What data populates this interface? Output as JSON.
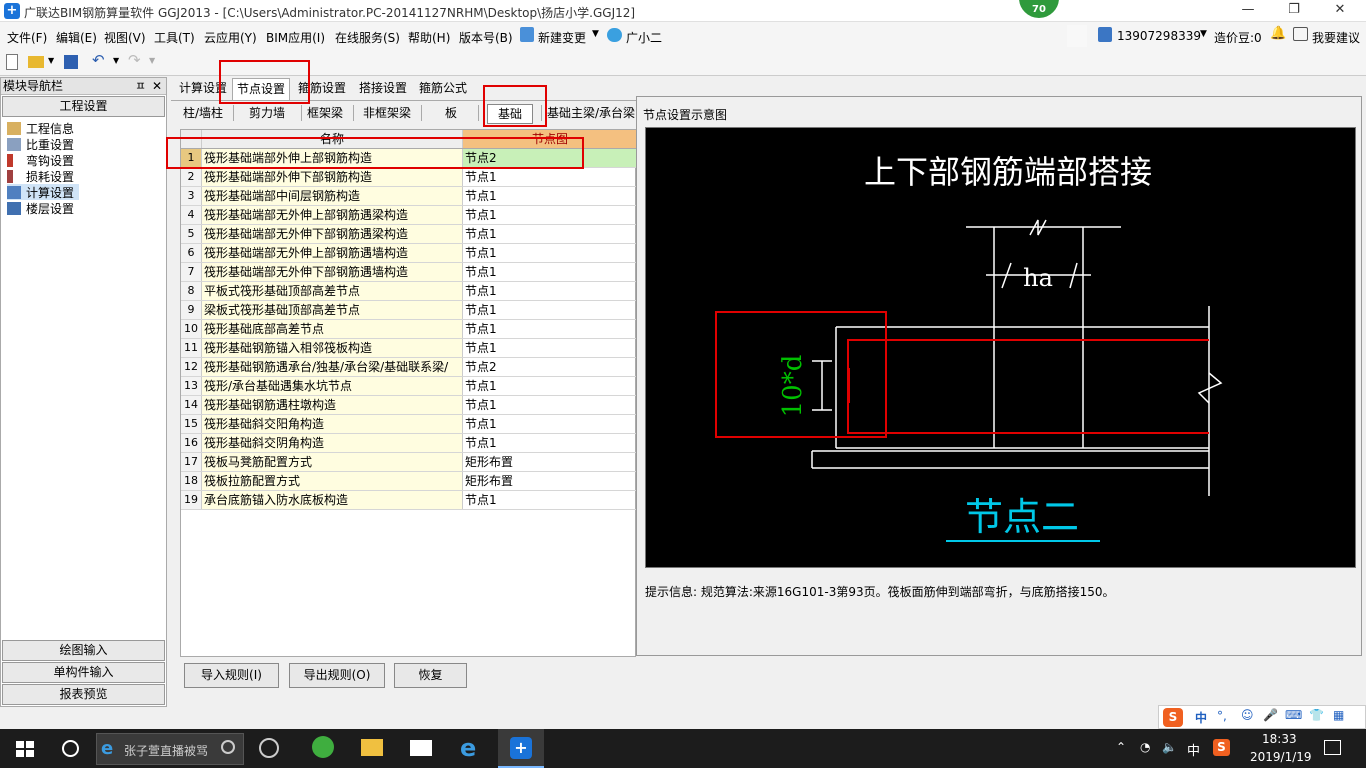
{
  "window": {
    "title": "广联达BIM钢筋算量软件 GGJ2013 - [C:\\Users\\Administrator.PC-20141127NRHM\\Desktop\\扬店小学.GGJ12]",
    "badge": "70",
    "minimize": "—",
    "maximize": "❐",
    "close": "✕"
  },
  "menu": [
    "文件(F)",
    "编辑(E)",
    "视图(V)",
    "工具(T)",
    "云应用(Y)",
    "BIM应用(I)",
    "在线服务(S)",
    "帮助(H)",
    "版本号(B)",
    "新建变更",
    "广小二"
  ],
  "menu_right": {
    "phone": "13907298339",
    "beans": "造价豆:0",
    "suggest": "我要建议"
  },
  "nav": {
    "title": "模块导航栏",
    "pin": "ㅍ",
    "close": "✕",
    "section_top": "工程设置",
    "items": [
      "工程信息",
      "比重设置",
      "弯钩设置",
      "损耗设置",
      "计算设置",
      "楼层设置"
    ],
    "sections_bottom": [
      "绘图输入",
      "单构件输入",
      "报表预览"
    ]
  },
  "tabs": [
    "计算设置",
    "节点设置",
    "箍筋设置",
    "搭接设置",
    "箍筋公式"
  ],
  "subtabs": [
    "柱/墙柱",
    "剪力墙",
    "框架梁",
    "非框架梁",
    "板",
    "基础",
    "基础主梁/承台梁"
  ],
  "grid": {
    "headers": [
      "名称",
      "节点图"
    ],
    "rows": [
      {
        "n": "1",
        "name": "筏形基础端部外伸上部钢筋构造",
        "value": "节点2"
      },
      {
        "n": "2",
        "name": "筏形基础端部外伸下部钢筋构造",
        "value": "节点1"
      },
      {
        "n": "3",
        "name": "筏形基础端部中间层钢筋构造",
        "value": "节点1"
      },
      {
        "n": "4",
        "name": "筏形基础端部无外伸上部钢筋遇梁构造",
        "value": "节点1"
      },
      {
        "n": "5",
        "name": "筏形基础端部无外伸下部钢筋遇梁构造",
        "value": "节点1"
      },
      {
        "n": "6",
        "name": "筏形基础端部无外伸上部钢筋遇墙构造",
        "value": "节点1"
      },
      {
        "n": "7",
        "name": "筏形基础端部无外伸下部钢筋遇墙构造",
        "value": "节点1"
      },
      {
        "n": "8",
        "name": "平板式筏形基础顶部高差节点",
        "value": "节点1"
      },
      {
        "n": "9",
        "name": "梁板式筏形基础顶部高差节点",
        "value": "节点1"
      },
      {
        "n": "10",
        "name": "筏形基础底部高差节点",
        "value": "节点1"
      },
      {
        "n": "11",
        "name": "筏形基础钢筋锚入相邻筏板构造",
        "value": "节点1"
      },
      {
        "n": "12",
        "name": "筏形基础钢筋遇承台/独基/承台梁/基础联系梁/",
        "value": "节点2"
      },
      {
        "n": "13",
        "name": "筏形/承台基础遇集水坑节点",
        "value": "节点1"
      },
      {
        "n": "14",
        "name": "筏形基础钢筋遇柱墩构造",
        "value": "节点1"
      },
      {
        "n": "15",
        "name": "筏形基础斜交阳角构造",
        "value": "节点1"
      },
      {
        "n": "16",
        "name": "筏形基础斜交阴角构造",
        "value": "节点1"
      },
      {
        "n": "17",
        "name": "筏板马凳筋配置方式",
        "value": "矩形布置"
      },
      {
        "n": "18",
        "name": "筏板拉筋配置方式",
        "value": "矩形布置"
      },
      {
        "n": "19",
        "name": "承台底筋锚入防水底板构造",
        "value": "节点1"
      }
    ]
  },
  "diagram": {
    "window_title": "节点设置示意图",
    "heading": "上下部钢筋端部搭接",
    "dim_ha": "ha",
    "dim_d": "10*d",
    "node_label": "节点二",
    "hint": "提示信息:  规范算法:来源16G101-3第93页。筏板面筋伸到端部弯折，与底筋搭接150。"
  },
  "buttons": [
    "导入规则(I)",
    "导出规则(O)",
    "恢复"
  ],
  "taskbar": {
    "search_placeholder": "张子萱直播被骂",
    "time": "18:33",
    "date": "2019/1/19",
    "ime": "中"
  },
  "ime_bar": [
    "中",
    "°,",
    "☺",
    "🎤",
    "⌨",
    "👕",
    "▦"
  ],
  "colors": {
    "highlight_box": "#e00000",
    "selected_value": "#c8f0b8",
    "name_cell": "#fffde0",
    "canvas_bg": "#000000",
    "dim_green": "#00c000",
    "node_cyan": "#00c8e8"
  }
}
